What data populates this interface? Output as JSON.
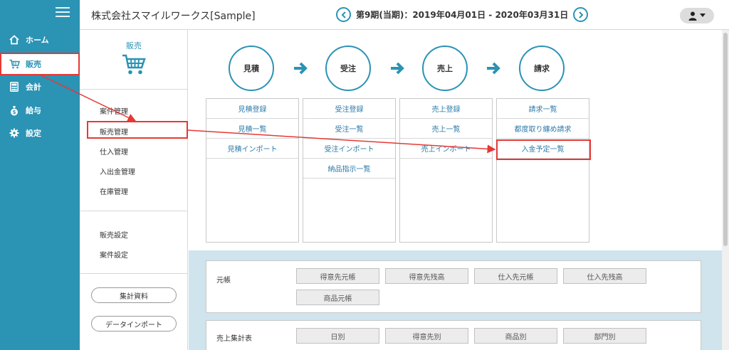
{
  "header": {
    "company": "株式会社スマイルワークス[Sample]",
    "period": "第9期(当期)：2019年04月01日 - 2020年03月31日"
  },
  "nav": {
    "items": [
      {
        "label": "ホーム",
        "icon": "home-icon"
      },
      {
        "label": "販売",
        "icon": "cart-icon"
      },
      {
        "label": "会計",
        "icon": "calculator-icon"
      },
      {
        "label": "給与",
        "icon": "money-bag-icon"
      },
      {
        "label": "設定",
        "icon": "gear-icon"
      }
    ],
    "active": "販売"
  },
  "sub": {
    "title": "販売",
    "links": [
      "案件管理",
      "販売管理",
      "仕入管理",
      "入出金管理",
      "在庫管理"
    ],
    "settings": [
      "販売設定",
      "案件設定"
    ],
    "buttons": [
      "集計資料",
      "データインポート"
    ]
  },
  "flow": {
    "stages": [
      "見積",
      "受注",
      "売上",
      "請求"
    ],
    "columns": [
      [
        "見積登録",
        "見積一覧",
        "見積インポート"
      ],
      [
        "受注登録",
        "受注一覧",
        "受注インポート",
        "納品指示一覧"
      ],
      [
        "売上登録",
        "売上一覧",
        "売上インポート"
      ],
      [
        "請求一覧",
        "都度取り纏め請求",
        "入金予定一覧"
      ]
    ]
  },
  "lower": {
    "ledger": {
      "label": "元帳",
      "buttons": [
        "得意先元帳",
        "得意先残高",
        "仕入先元帳",
        "仕入先残高",
        "商品元帳"
      ]
    },
    "summary": {
      "label": "売上集計表",
      "buttons": [
        "日別",
        "得意先別",
        "商品別",
        "部門別"
      ]
    }
  },
  "colors": {
    "accent": "#2b93b4",
    "highlight": "#e53935",
    "lower_bg": "#cfe4ec"
  }
}
